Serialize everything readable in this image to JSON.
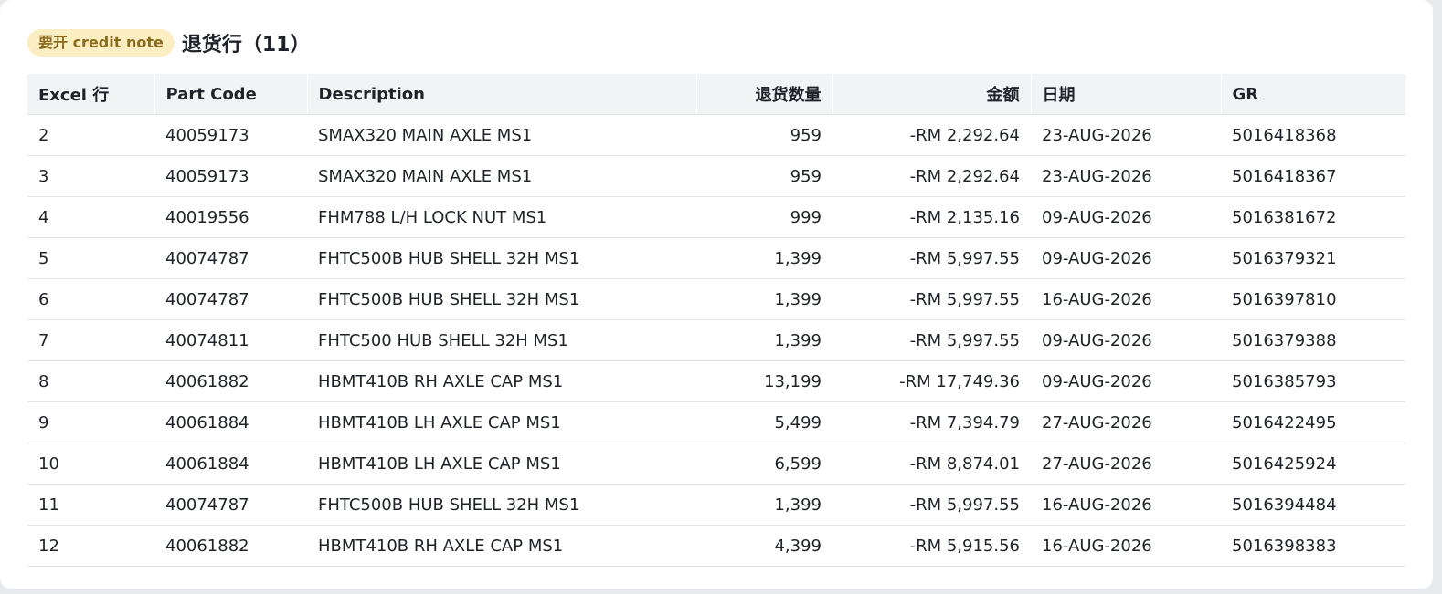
{
  "header": {
    "badge": "要开 credit note",
    "title": "退货行（11）"
  },
  "colors": {
    "badge_bg": "#fbeec2",
    "badge_text": "#8a6a1c",
    "header_bg": "#f2f3f5"
  },
  "table": {
    "columns": [
      "Excel 行",
      "Part Code",
      "Description",
      "退货数量",
      "金额",
      "日期",
      "GR"
    ],
    "rows": [
      [
        "2",
        "40059173",
        "SMAX320 MAIN AXLE MS1",
        "959",
        "-RM 2,292.64",
        "23-AUG-2026",
        "5016418368"
      ],
      [
        "3",
        "40059173",
        "SMAX320 MAIN AXLE MS1",
        "959",
        "-RM 2,292.64",
        "23-AUG-2026",
        "5016418367"
      ],
      [
        "4",
        "40019556",
        "FHM788 L/H LOCK NUT MS1",
        "999",
        "-RM 2,135.16",
        "09-AUG-2026",
        "5016381672"
      ],
      [
        "5",
        "40074787",
        "FHTC500B HUB SHELL 32H MS1",
        "1,399",
        "-RM 5,997.55",
        "09-AUG-2026",
        "5016379321"
      ],
      [
        "6",
        "40074787",
        "FHTC500B HUB SHELL 32H MS1",
        "1,399",
        "-RM 5,997.55",
        "16-AUG-2026",
        "5016397810"
      ],
      [
        "7",
        "40074811",
        "FHTC500 HUB SHELL 32H MS1",
        "1,399",
        "-RM 5,997.55",
        "09-AUG-2026",
        "5016379388"
      ],
      [
        "8",
        "40061882",
        "HBMT410B RH AXLE CAP MS1",
        "13,199",
        "-RM 17,749.36",
        "09-AUG-2026",
        "5016385793"
      ],
      [
        "9",
        "40061884",
        "HBMT410B LH AXLE CAP MS1",
        "5,499",
        "-RM 7,394.79",
        "27-AUG-2026",
        "5016422495"
      ],
      [
        "10",
        "40061884",
        "HBMT410B LH AXLE CAP MS1",
        "6,599",
        "-RM 8,874.01",
        "27-AUG-2026",
        "5016425924"
      ],
      [
        "11",
        "40074787",
        "FHTC500B HUB SHELL 32H MS1",
        "1,399",
        "-RM 5,997.55",
        "16-AUG-2026",
        "5016394484"
      ],
      [
        "12",
        "40061882",
        "HBMT410B RH AXLE CAP MS1",
        "4,399",
        "-RM 5,915.56",
        "16-AUG-2026",
        "5016398383"
      ]
    ]
  }
}
